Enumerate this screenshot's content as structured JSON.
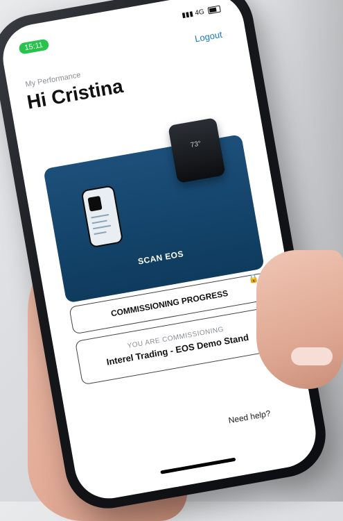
{
  "status": {
    "time": "15:11",
    "network": "4G"
  },
  "header": {
    "logout": "Logout",
    "kicker": "My Performance",
    "greeting": "Hi Cristina"
  },
  "cards": {
    "scan": {
      "label": "SCAN EOS"
    },
    "progress": {
      "label": "COMMISSIONING PROGRESS"
    },
    "commissioning": {
      "subtitle": "YOU ARE COMMISSIONING",
      "value": "Interel Trading - EOS Demo Stand"
    }
  },
  "help": {
    "label": "Need help?"
  },
  "thermostat": {
    "temperature": "73°"
  },
  "colors": {
    "accent": "#1a78c2",
    "scan_card": "#0f3c60",
    "status_green": "#27c34a"
  },
  "icons": {
    "lock": "lock-icon",
    "battery": "battery-icon",
    "signal": "signal-icon"
  }
}
